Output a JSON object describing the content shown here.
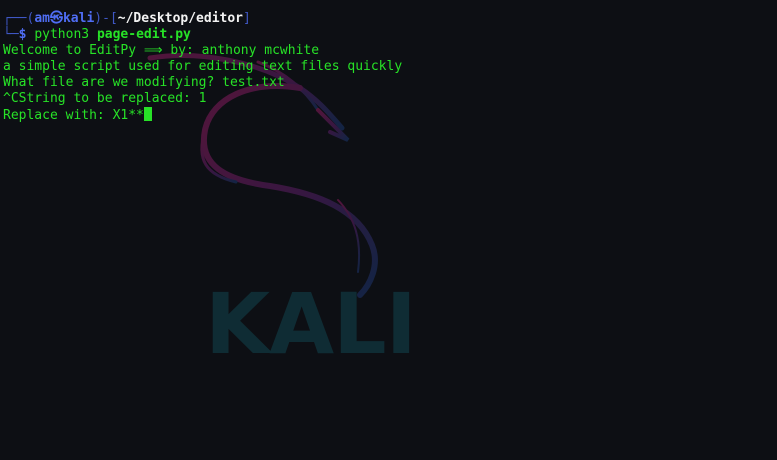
{
  "prompt": {
    "frame_open": "┌──(",
    "user": "am",
    "at_symbol": "㉿",
    "host": "kali",
    "frame_mid": ")-[",
    "path": "~/Desktop/editor",
    "frame_close": "]",
    "frame_bottom": "└─",
    "sign": "$",
    "command": "python3",
    "argument": "page-edit.py"
  },
  "output": [
    "Welcome to EditPy ⟹ by: anthony mcwhite",
    "a simple script used for editing text files quickly",
    "What file are we modifying? test.txt",
    "^CString to be replaced: 1",
    "Replace with: X1**"
  ],
  "background": {
    "wordmark": "KALI",
    "logo": "kali-dragon-icon"
  },
  "colors": {
    "background": "#0d0f14",
    "text": "#27e227",
    "prompt": "#4f6df4",
    "path": "#f2f2f2"
  }
}
